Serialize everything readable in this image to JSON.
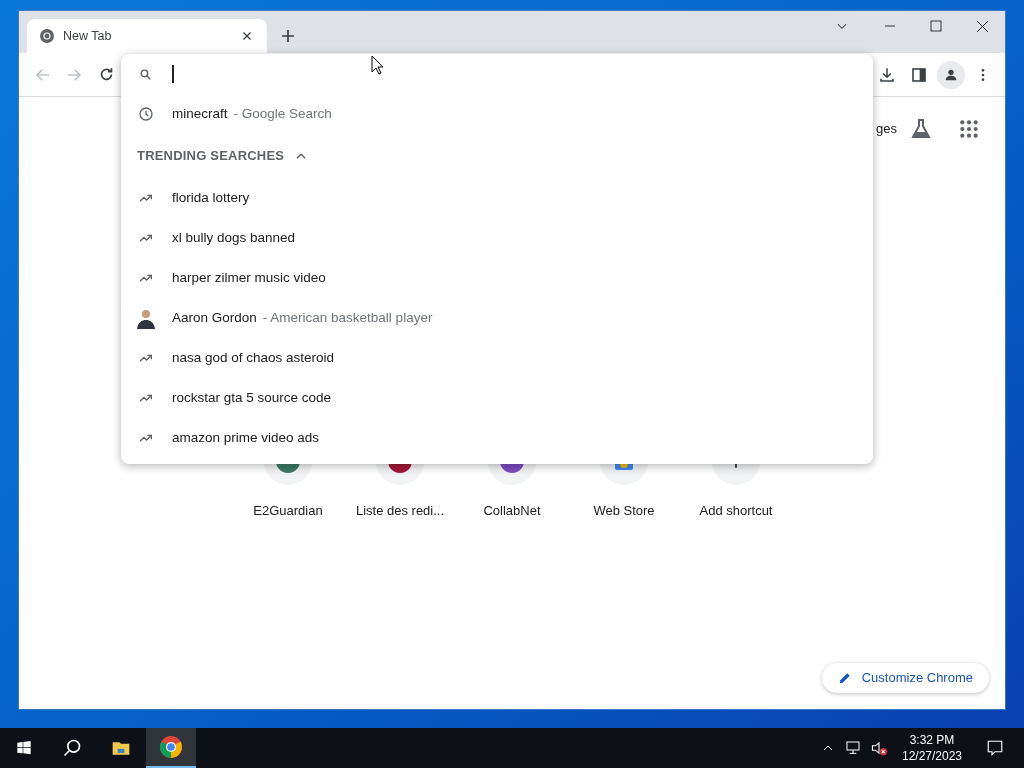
{
  "window": {
    "tab": {
      "title": "New Tab"
    }
  },
  "suggestions": [
    {
      "kind": "history",
      "text": "minecraft",
      "detail": "- Google Search"
    }
  ],
  "trending": {
    "header": "TRENDING SEARCHES",
    "expanded": true,
    "items": [
      {
        "kind": "trend",
        "text": "florida lottery"
      },
      {
        "kind": "trend",
        "text": "xl bully dogs banned"
      },
      {
        "kind": "trend",
        "text": "harper zilmer music video"
      },
      {
        "kind": "entity",
        "text": "Aaron Gordon",
        "detail": "- American basketball player"
      },
      {
        "kind": "trend",
        "text": "nasa god of chaos asteroid"
      },
      {
        "kind": "trend",
        "text": "rockstar gta 5 source code"
      },
      {
        "kind": "trend",
        "text": "amazon prime video ads"
      }
    ]
  },
  "new_tab_page": {
    "header_link": "ges",
    "shortcuts": [
      {
        "kind": "site",
        "label": "E2Guardian",
        "color": "#3f7a66"
      },
      {
        "kind": "site",
        "label": "Liste des redi...",
        "color": "#a3173a"
      },
      {
        "kind": "site",
        "label": "CollabNet",
        "color": "#7e4cc4"
      },
      {
        "kind": "store",
        "label": "Web Store"
      },
      {
        "kind": "add",
        "label": "Add shortcut"
      }
    ],
    "customize": "Customize Chrome"
  },
  "taskbar": {
    "time": "3:32 PM",
    "date": "12/27/2023"
  }
}
